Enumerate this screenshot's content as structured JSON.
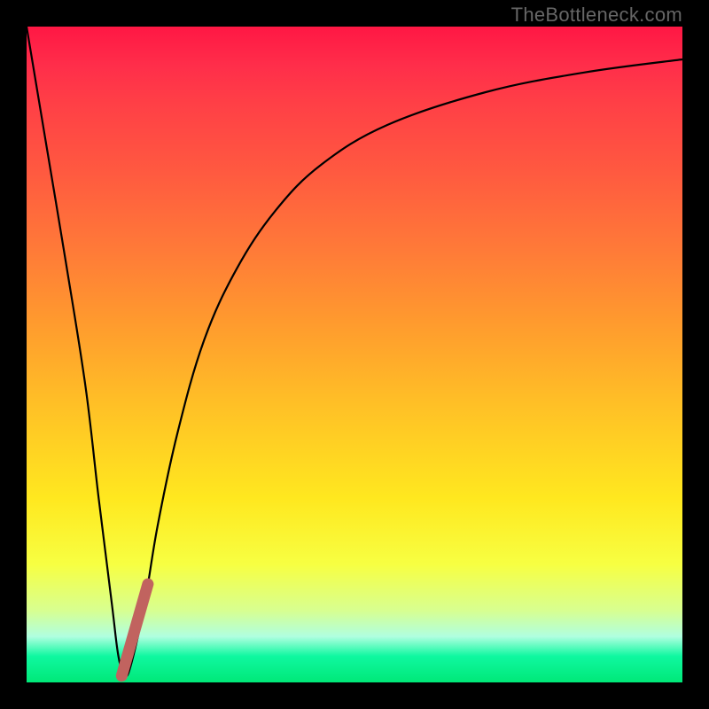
{
  "attribution": "TheBottleneck.com",
  "chart_data": {
    "type": "line",
    "title": "",
    "xlabel": "",
    "ylabel": "",
    "xlim": [
      0,
      100
    ],
    "ylim": [
      0,
      100
    ],
    "background": "red-to-green vertical gradient (bottleneck severity)",
    "series": [
      {
        "name": "bottleneck-curve",
        "color": "#000000",
        "stroke_width": 2,
        "x": [
          0,
          3,
          6,
          9,
          11,
          13,
          14,
          15,
          16,
          18,
          20,
          23,
          27,
          32,
          38,
          45,
          55,
          70,
          85,
          100
        ],
        "y": [
          100,
          82,
          64,
          45,
          28,
          12,
          4,
          1,
          3,
          12,
          24,
          38,
          52,
          63,
          72,
          79,
          85,
          90,
          93,
          95
        ]
      },
      {
        "name": "highlight-segment",
        "color": "#c1635f",
        "stroke_width": 13,
        "linecap": "round",
        "x": [
          14.5,
          18.5
        ],
        "y": [
          1,
          15
        ]
      }
    ]
  }
}
